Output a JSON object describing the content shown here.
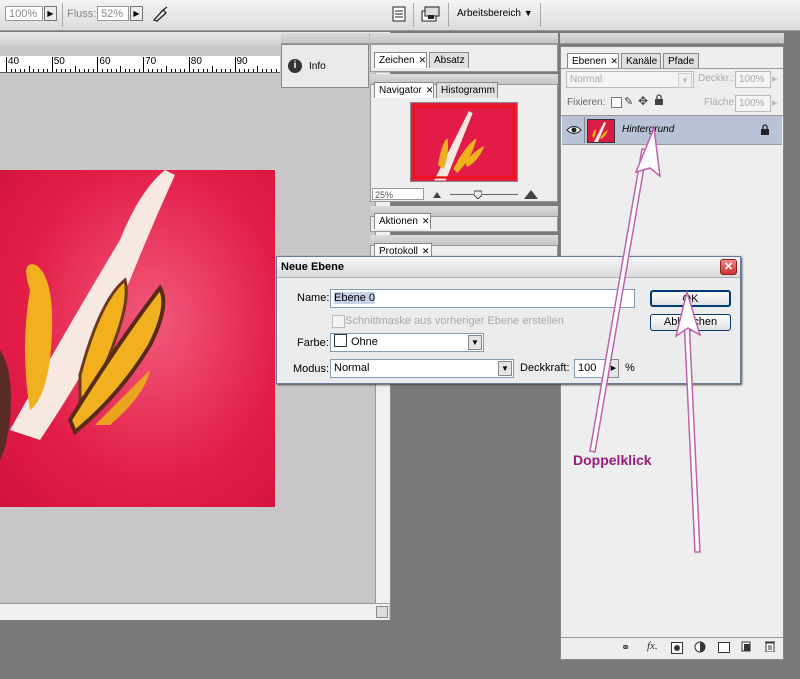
{
  "toolbar": {
    "opacity_value": "100%",
    "flow_label": "Fluss:",
    "flow_value": "52%",
    "workspace_label": "Arbeitsbereich"
  },
  "ruler": {
    "labels": [
      "40",
      "50",
      "60",
      "70",
      "80",
      "90",
      "10"
    ]
  },
  "panels": {
    "info_label": "Info",
    "zeichen_tab": "Zeichen",
    "absatz_tab": "Absatz",
    "navigator_tab": "Navigator",
    "histogramm_tab": "Histogramm",
    "navigator_zoom": "25%",
    "aktionen_tab": "Aktionen",
    "protokoll_tab": "Protokoll"
  },
  "layers_panel": {
    "tabs": [
      "Ebenen",
      "Kanäle",
      "Pfade"
    ],
    "blend_mode": "Normal",
    "opacity_label": "Deckkr.:",
    "opacity_value": "100%",
    "lock_label": "Fixieren:",
    "fill_label": "Fläche:",
    "fill_value": "100%",
    "layer_name": "Hintergrund"
  },
  "dialog": {
    "title": "Neue Ebene",
    "name_label": "Name:",
    "name_value": "Ebene 0",
    "clipping_label": "Schnittmaske aus vorheriger Ebene erstellen",
    "color_label": "Farbe:",
    "color_value": "Ohne",
    "mode_label": "Modus:",
    "mode_value": "Normal",
    "opacity_label": "Deckkraft:",
    "opacity_value": "100",
    "opacity_unit": "%",
    "ok_label": "OK",
    "cancel_label": "Abbrechen"
  },
  "annotation": {
    "text": "Doppelklick",
    "color": "#9b1a7a"
  },
  "colors": {
    "photo_magenta": "#e51e48",
    "layer_selected": "#b9c3d8"
  }
}
